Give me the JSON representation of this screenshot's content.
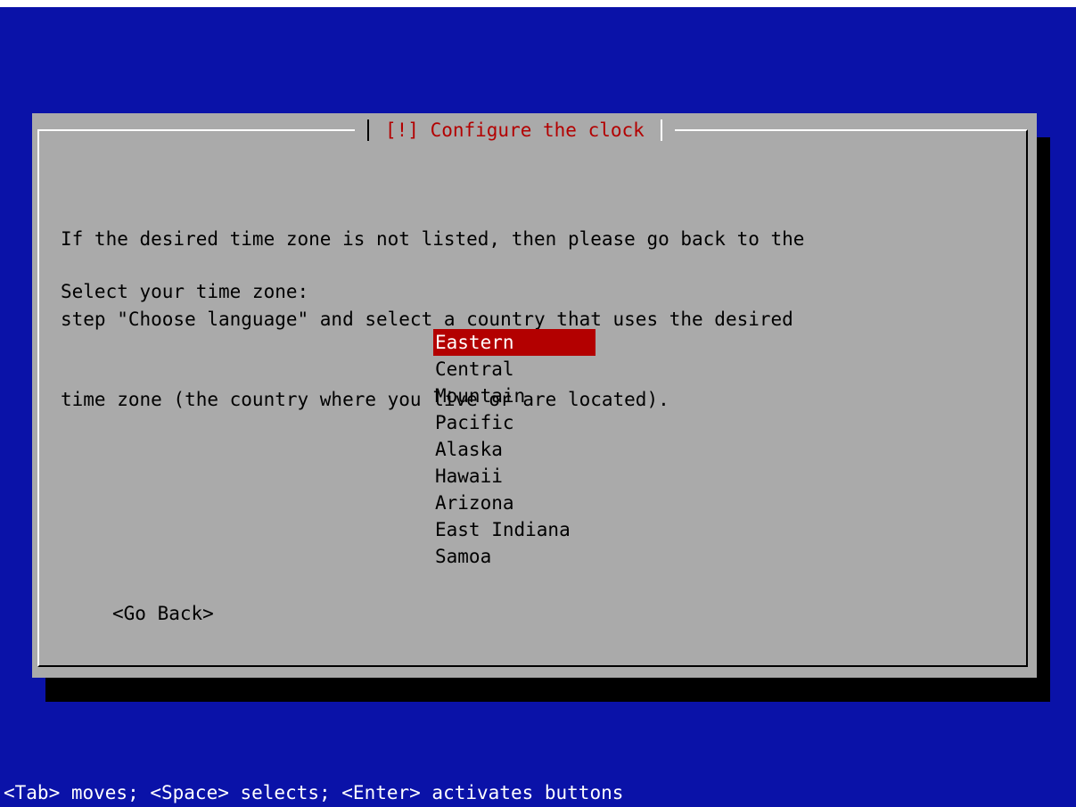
{
  "colors": {
    "background": "#0a12a8",
    "dialog": "#aaaaaa",
    "accent": "#b30000",
    "text": "#000000",
    "status_text": "#ffffff"
  },
  "dialog": {
    "title": "[!] Configure the clock",
    "description_lines": [
      "If the desired time zone is not listed, then please go back to the",
      "step \"Choose language\" and select a country that uses the desired",
      "time zone (the country where you live or are located)."
    ],
    "prompt": "Select your time zone:",
    "selected_index": 0,
    "timezones": [
      "Eastern",
      "Central",
      "Mountain",
      "Pacific",
      "Alaska",
      "Hawaii",
      "Arizona",
      "East Indiana",
      "Samoa"
    ],
    "go_back_label": "<Go Back>"
  },
  "statusbar": {
    "text": "<Tab> moves; <Space> selects; <Enter> activates buttons"
  }
}
